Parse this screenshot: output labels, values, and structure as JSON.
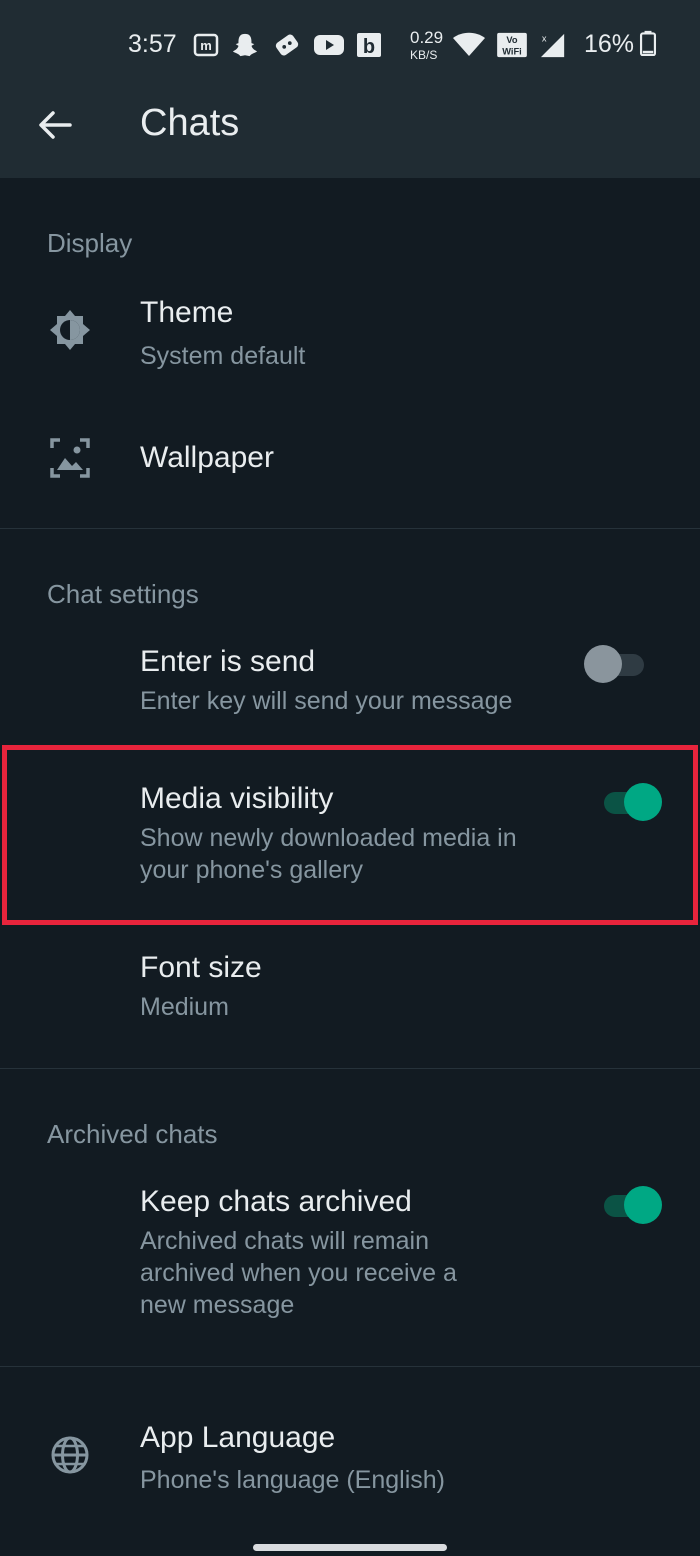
{
  "status_bar": {
    "time": "3:57",
    "net_speed_value": "0.29",
    "net_speed_unit": "KB/S",
    "battery_percent": "16%",
    "icons": [
      "m-icon",
      "snapchat-icon",
      "game-controller-icon",
      "youtube-icon",
      "b-icon",
      "wifi-icon",
      "vowifi-icon",
      "signal-icon",
      "battery-icon"
    ]
  },
  "header": {
    "title": "Chats",
    "back_icon": "arrow-left-icon"
  },
  "display": {
    "header": "Display",
    "theme": {
      "title": "Theme",
      "subtitle": "System default",
      "icon": "theme-icon"
    },
    "wallpaper": {
      "title": "Wallpaper",
      "icon": "wallpaper-icon"
    }
  },
  "chat_settings": {
    "header": "Chat settings",
    "enter_is_send": {
      "title": "Enter is send",
      "subtitle": "Enter key will send your message",
      "enabled": false
    },
    "media_visibility": {
      "title": "Media visibility",
      "subtitle_line1": "Show newly downloaded media in",
      "subtitle_line2": "your phone's gallery",
      "enabled": true
    },
    "font_size": {
      "title": "Font size",
      "subtitle": "Medium"
    }
  },
  "archived": {
    "header": "Archived chats",
    "keep_archived": {
      "title": "Keep chats archived",
      "subtitle_line1": "Archived chats will remain",
      "subtitle_line2": "archived when you receive a",
      "subtitle_line3": "new message",
      "enabled": true
    }
  },
  "app_language": {
    "title": "App Language",
    "subtitle": "Phone's language (English)",
    "icon": "globe-icon"
  },
  "colors": {
    "background": "#121b22",
    "appbar": "#202c33",
    "accent": "#00a884",
    "highlight": "#e8243c",
    "secondary_text": "#8696a0"
  }
}
